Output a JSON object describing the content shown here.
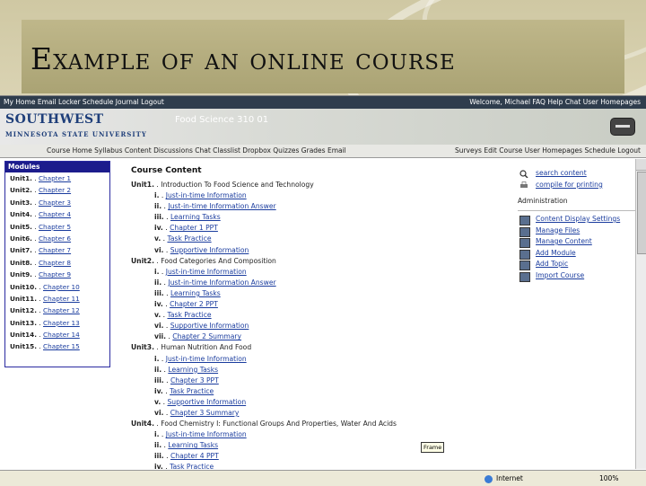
{
  "slide": {
    "title": "Example of an online course"
  },
  "topbar": {
    "left": "My Home  Email  Locker  Schedule  Journal  Logout",
    "right": "Welcome, Michael  FAQ  Help  Chat  User Homepages"
  },
  "header": {
    "logo_main": "SOUTHWEST",
    "logo_sub": "MINNESOTA STATE UNIVERSITY",
    "course_name": "Food Science 310 01"
  },
  "navbar": {
    "left": "Course Home  Syllabus  Content  Discussions  Chat  Classlist  Dropbox  Quizzes  Grades  Email",
    "right": "Surveys  Edit Course  User Homepages  Schedule  Logout"
  },
  "modules": {
    "heading": "Modules",
    "items": [
      {
        "unit": "Unit1.",
        "chapter": "Chapter 1"
      },
      {
        "unit": "Unit2.",
        "chapter": "Chapter 2"
      },
      {
        "unit": "Unit3.",
        "chapter": "Chapter 3"
      },
      {
        "unit": "Unit4.",
        "chapter": "Chapter 4"
      },
      {
        "unit": "Unit5.",
        "chapter": "Chapter 5"
      },
      {
        "unit": "Unit6.",
        "chapter": "Chapter 6"
      },
      {
        "unit": "Unit7.",
        "chapter": "Chapter 7"
      },
      {
        "unit": "Unit8.",
        "chapter": "Chapter 8"
      },
      {
        "unit": "Unit9.",
        "chapter": "Chapter 9"
      },
      {
        "unit": "Unit10.",
        "chapter": "Chapter 10"
      },
      {
        "unit": "Unit11.",
        "chapter": "Chapter 11"
      },
      {
        "unit": "Unit12.",
        "chapter": "Chapter 12"
      },
      {
        "unit": "Unit13.",
        "chapter": "Chapter 13"
      },
      {
        "unit": "Unit14.",
        "chapter": "Chapter 14"
      },
      {
        "unit": "Unit15.",
        "chapter": "Chapter 15"
      }
    ]
  },
  "content": {
    "title": "Course Content",
    "units": [
      {
        "label": "Unit1.",
        "name": "Introduction To Food Science and Technology",
        "items": [
          {
            "num": "i.",
            "text": "Just-in-time Information"
          },
          {
            "num": "ii.",
            "text": "Just-in-time Information Answer"
          },
          {
            "num": "iii.",
            "text": "Learning Tasks"
          },
          {
            "num": "iv.",
            "text": "Chapter 1 PPT"
          },
          {
            "num": "v.",
            "text": "Task Practice"
          },
          {
            "num": "vi.",
            "text": "Supportive Information"
          }
        ]
      },
      {
        "label": "Unit2.",
        "name": "Food Categories And Composition",
        "items": [
          {
            "num": "i.",
            "text": "Just-in-time Information"
          },
          {
            "num": "ii.",
            "text": "Just-in-time Information Answer"
          },
          {
            "num": "iii.",
            "text": "Learning Tasks"
          },
          {
            "num": "iv.",
            "text": "Chapter 2 PPT"
          },
          {
            "num": "v.",
            "text": "Task Practice"
          },
          {
            "num": "vi.",
            "text": "Supportive Information"
          },
          {
            "num": "vii.",
            "text": "Chapter 2 Summary"
          }
        ]
      },
      {
        "label": "Unit3.",
        "name": "Human Nutrition And Food",
        "items": [
          {
            "num": "i.",
            "text": "Just-in-time Information"
          },
          {
            "num": "ii.",
            "text": "Learning Tasks"
          },
          {
            "num": "iii.",
            "text": "Chapter 3 PPT"
          },
          {
            "num": "iv.",
            "text": "Task Practice"
          },
          {
            "num": "v.",
            "text": "Supportive Information"
          },
          {
            "num": "vi.",
            "text": "Chapter 3 Summary"
          }
        ]
      },
      {
        "label": "Unit4.",
        "name": "Food Chemistry I: Functional Groups And Properties, Water And Acids",
        "items": [
          {
            "num": "i.",
            "text": "Just-in-time Information"
          },
          {
            "num": "ii.",
            "text": "Learning Tasks"
          },
          {
            "num": "iii.",
            "text": "Chapter 4 PPT"
          },
          {
            "num": "iv.",
            "text": "Task Practice"
          }
        ]
      }
    ]
  },
  "rightpanel": {
    "search": "search content",
    "compile": "compile for printing",
    "admin_heading": "Administration",
    "admin_items": [
      "Content Display Settings",
      "Manage Files",
      "Manage Content",
      "Add Module",
      "Add Topic",
      "Import Course"
    ]
  },
  "tooltip": "Frame",
  "statusbar": {
    "zone": "Internet",
    "zoom": "100%"
  }
}
